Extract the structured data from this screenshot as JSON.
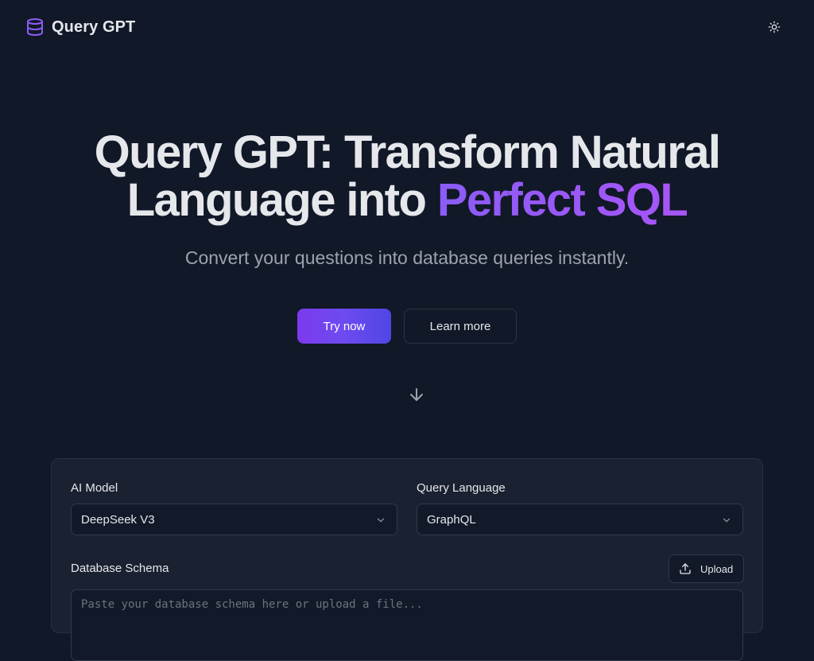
{
  "header": {
    "brand_name": "Query GPT",
    "brand_icon": "database-icon",
    "theme_toggle_icon": "sun-icon"
  },
  "hero": {
    "title_line1": "Query GPT: Transform Natural",
    "title_line2_plain": "Language into ",
    "title_line2_accent": "Perfect SQL",
    "subtitle": "Convert your questions into database queries instantly.",
    "primary_button": "Try now",
    "secondary_button": "Learn more",
    "scroll_icon": "arrow-down-icon"
  },
  "form": {
    "ai_model_label": "AI Model",
    "ai_model_value": "DeepSeek V3",
    "query_language_label": "Query Language",
    "query_language_value": "GraphQL",
    "schema_label": "Database Schema",
    "upload_label": "Upload",
    "upload_icon": "upload-icon",
    "schema_placeholder": "Paste your database schema here or upload a file..."
  },
  "colors": {
    "background": "#111827",
    "panel": "#1a2130",
    "accent_start": "#7c3aed",
    "accent_end": "#4f46e5",
    "text_primary": "#e5e7eb",
    "text_muted": "#9ca3af"
  }
}
